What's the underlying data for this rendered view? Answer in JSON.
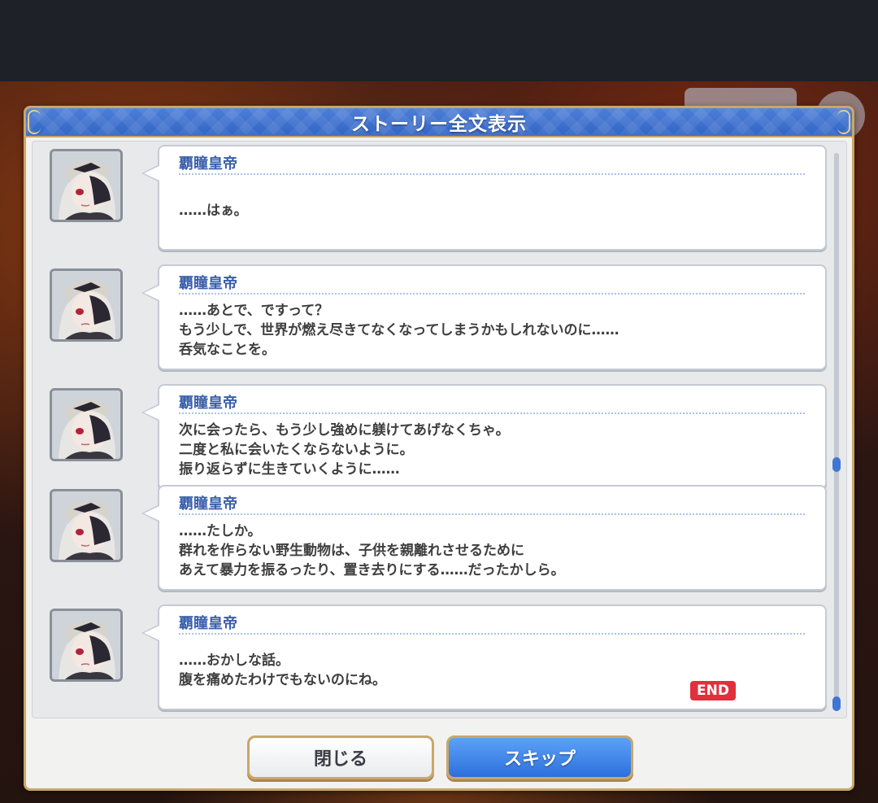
{
  "dialog": {
    "title": "ストーリー全文表示"
  },
  "entries": [
    {
      "speaker": "覇瞳皇帝",
      "lines": [
        "……はぁ。"
      ]
    },
    {
      "speaker": "覇瞳皇帝",
      "lines": [
        "……あとで、ですって？",
        "もう少しで、世界が燃え尽きてなくなってしまうかもしれないのに……",
        "呑気なことを。"
      ]
    },
    {
      "speaker": "覇瞳皇帝",
      "lines": [
        "次に会ったら、もう少し強めに躾けてあげなくちゃ。",
        "二度と私に会いたくならないように。",
        "振り返らずに生きていくように……"
      ]
    },
    {
      "speaker": "覇瞳皇帝",
      "lines": [
        "……たしか。",
        "群れを作らない野生動物は、子供を親離れさせるために",
        "あえて暴力を振るったり、置き去りにする……だったかしら。"
      ]
    },
    {
      "speaker": "覇瞳皇帝",
      "lines": [
        "……おかしな話。",
        "腹を痛めたわけでもないのにね。"
      ]
    }
  ],
  "end_badge": "END",
  "buttons": {
    "close": "閉じる",
    "skip": "スキップ"
  },
  "colors": {
    "header_blue": "#3a6cd0",
    "gold_border": "#c9a768",
    "speaker_blue": "#3a5faa",
    "end_red": "#e0303c",
    "skip_blue": "#2e6fdc"
  }
}
